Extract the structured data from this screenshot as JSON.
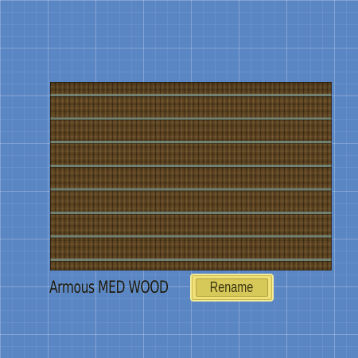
{
  "floor_item": {
    "name": "Armous MED WOOD",
    "preview": "wood-floor-texture"
  },
  "actions": {
    "rename_label": "Rename"
  },
  "colors": {
    "background_grid": "#5a87c4",
    "wood": "#5b4220",
    "plank_gap": "#78968c",
    "button": "#efe07a",
    "button_inner": "#d7c85a",
    "text": "#1a1608"
  }
}
